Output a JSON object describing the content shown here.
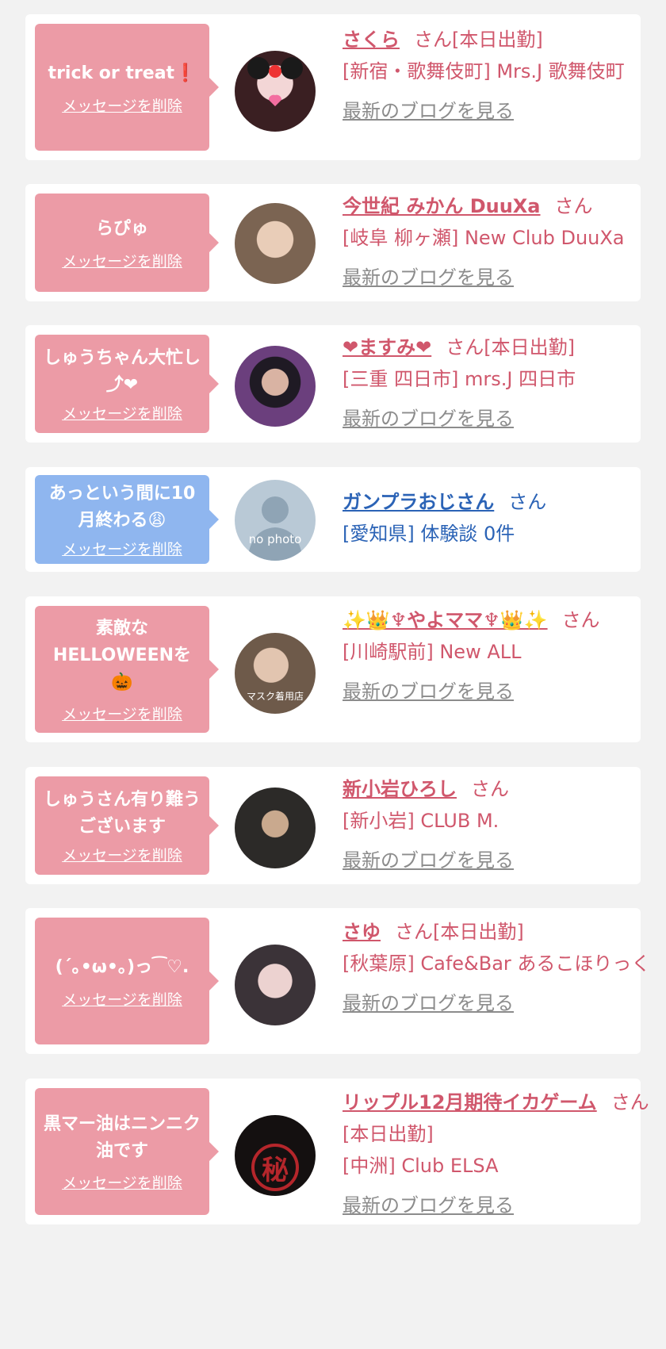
{
  "delete_label": "メッセージを削除",
  "blog_label": "最新のブログを見る",
  "colors": {
    "pink": "#ec9ba6",
    "blue": "#8fb6ef",
    "name_pink": "#d0576c",
    "name_blue": "#2b63b6"
  },
  "items": [
    {
      "message": "trick or treat❗",
      "name": "さくら",
      "suffix": "さん[本日出勤]",
      "place": "[新宿・歌舞伎町] Mrs.J 歌舞伎町"
    },
    {
      "message": "らぴゅ",
      "name": "今世紀 みかん DuuXa",
      "suffix": "さん",
      "place": "[岐阜 柳ヶ瀬] New Club DuuXa"
    },
    {
      "message": "しゅうちゃん大忙し⤴❤",
      "name": "❤ますみ❤",
      "suffix": "さん[本日出勤]",
      "place": "[三重 四日市] mrs.J 四日市"
    },
    {
      "message": "あっという間に10月終わる😩",
      "name": "ガンプラおじさん",
      "suffix": "さん",
      "place": "[愛知県] 体験談 0件",
      "avatar_text": "no photo"
    },
    {
      "message": "素敵なHELLOWEENを🎃",
      "name": "✨👑♆やよママ♆👑✨",
      "suffix": "さん",
      "place": "[川崎駅前] New ALL",
      "avatar_text": "マスク着用店"
    },
    {
      "message": "しゅうさん有り難うございます",
      "name": "新小岩ひろし",
      "suffix": "さん",
      "place": "[新小岩] CLUB M."
    },
    {
      "message": "(´｡•ω•｡)っ⁀♡.",
      "name": "さゆ",
      "suffix": "さん[本日出勤]",
      "place": "[秋葉原] Cafe&Bar あるこほりっく"
    },
    {
      "message": "黒マー油はニンニク油です",
      "name": "リップル12月期待イカゲーム",
      "suffix": "さん[本日出勤]",
      "place": "[中洲] Club ELSA",
      "avatar_text": "秘"
    }
  ]
}
